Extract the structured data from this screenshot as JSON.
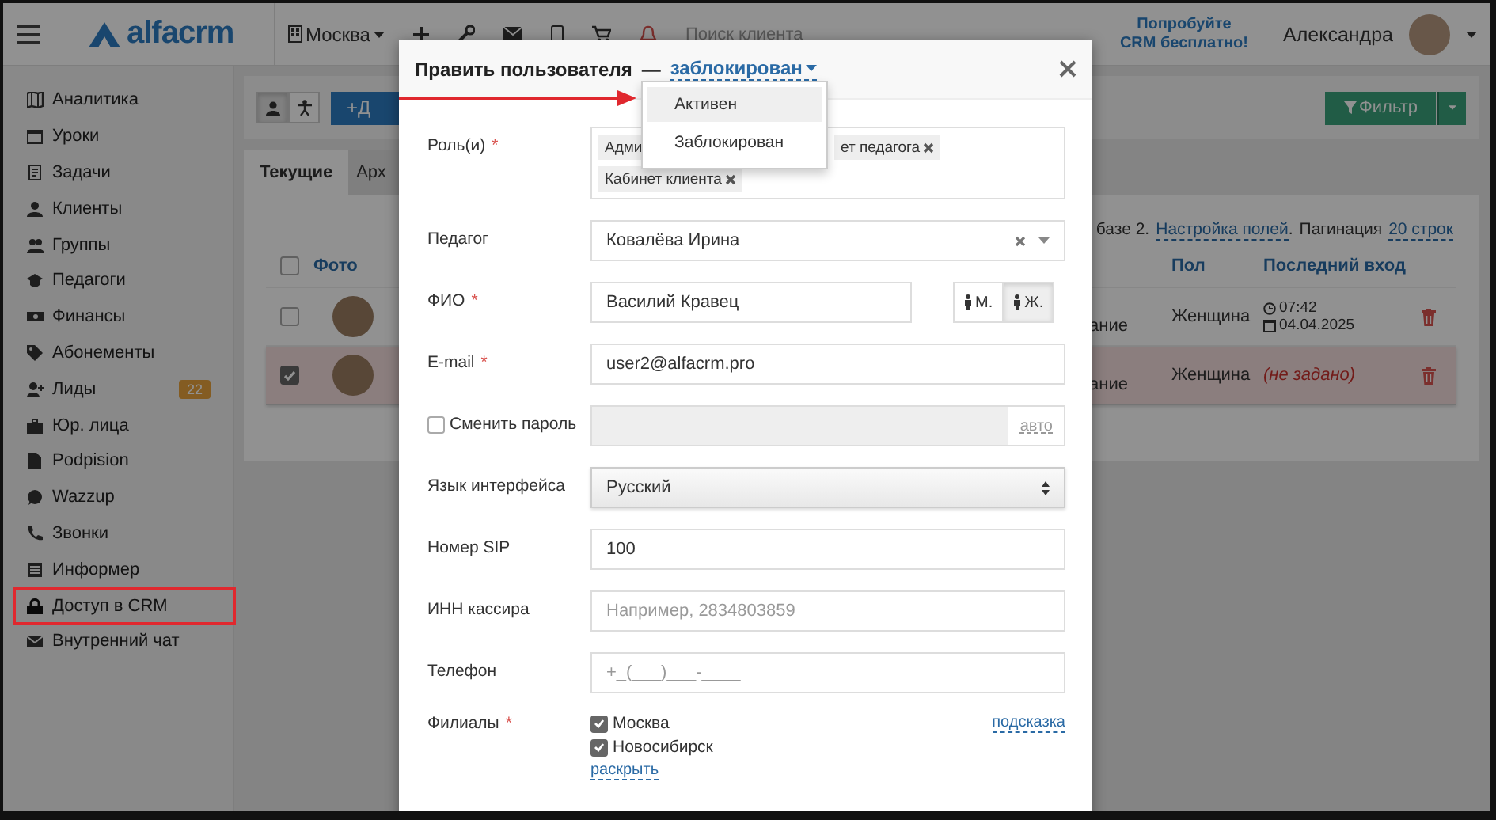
{
  "topbar": {
    "logo": "alfacrm",
    "branch": "Москва",
    "search": {
      "placeholder": "Поиск клиента"
    },
    "promo": [
      "Попробуйте",
      "CRM бесплатно!"
    ],
    "user": "Александра"
  },
  "sidebar": {
    "items": [
      {
        "label": "Аналитика",
        "highlighted": false
      },
      {
        "label": "Уроки",
        "highlighted": false
      },
      {
        "label": "Задачи",
        "highlighted": false
      },
      {
        "label": "Клиенты",
        "highlighted": false
      },
      {
        "label": "Группы",
        "highlighted": false
      },
      {
        "label": "Педагоги",
        "highlighted": false
      },
      {
        "label": "Финансы",
        "highlighted": false
      },
      {
        "label": "Абонементы",
        "highlighted": false
      },
      {
        "label": "Лиды",
        "badge": "22",
        "highlighted": false
      },
      {
        "label": "Юр. лица",
        "highlighted": false
      },
      {
        "label": "Podpision",
        "highlighted": false
      },
      {
        "label": "Wazzup",
        "highlighted": false
      },
      {
        "label": "Звонки",
        "highlighted": false
      },
      {
        "label": "Информер",
        "highlighted": false
      },
      {
        "label": "Доступ в CRM",
        "highlighted": true
      },
      {
        "label": "Внутренний чат",
        "highlighted": false
      }
    ]
  },
  "toolbar": {
    "view_toggles": [
      {
        "selected": true
      },
      {
        "selected": false
      }
    ],
    "add_button": "+Д",
    "filter_button": "Фильтр"
  },
  "tabs": [
    {
      "label": "Текущие",
      "selected": true
    },
    {
      "label": "Арх",
      "selected": false
    }
  ],
  "table": {
    "info": "базе 2.",
    "settings_link": "Настройка полей",
    "settings_suffix": ".",
    "pagination_label": "Пагинация",
    "pagination_link": "20 строк",
    "all_checked": false,
    "columns": {
      "photo": "Фото",
      "gender": "Пол",
      "last_login": "Последний вход"
    },
    "rows": [
      {
        "checked": false,
        "column_3": "ание",
        "gender": "Женщина",
        "last_login": {
          "kind": "datetime",
          "time": "07:42",
          "date": "04.04.2025"
        }
      },
      {
        "checked": true,
        "column_3": "ание",
        "gender": "Женщина",
        "last_login": {
          "kind": "unset",
          "text": "(не задано)"
        }
      }
    ]
  },
  "modal": {
    "title": "Править пользователя",
    "separator": "—",
    "status": "заблокирован",
    "status_menu": [
      {
        "label": "Активен",
        "highlighted": true
      },
      {
        "label": "Заблокирован",
        "highlighted": false
      }
    ],
    "fields": [
      {
        "kind": "tags",
        "label": "Роль(и)",
        "required_mark": "*",
        "tags": [
          "Адми",
          "ет педагога",
          "Кабинет клиента"
        ]
      },
      {
        "kind": "select2",
        "label": "Педагог",
        "value": "Ковалёва Ирина"
      },
      {
        "kind": "gender",
        "label": "ФИО",
        "required_mark": "*",
        "value": "Василий Кравец",
        "options": [
          {
            "label": "М.",
            "selected": false
          },
          {
            "label": "Ж.",
            "selected": true
          }
        ]
      },
      {
        "kind": "text",
        "label": "E-mail",
        "required_mark": "*",
        "value": "user2@alfacrm.pro"
      },
      {
        "kind": "password",
        "label": "Сменить пароль",
        "checked": false,
        "button": "авто"
      },
      {
        "kind": "select",
        "label": "Язык интерфейса",
        "value": "Русский"
      },
      {
        "kind": "text",
        "label": "Номер SIP",
        "value": "100"
      },
      {
        "kind": "text",
        "label": "ИНН кассира",
        "placeholder": "Например, 2834803859"
      },
      {
        "kind": "text",
        "label": "Телефон",
        "placeholder": "+_(___)___-____"
      },
      {
        "kind": "checklist",
        "label": "Филиалы",
        "required_mark": "*",
        "items": [
          {
            "label": "Москва",
            "checked": true
          },
          {
            "label": "Новосибирск",
            "checked": true
          }
        ],
        "hint": "подсказка",
        "more": "раскрыть"
      }
    ]
  }
}
